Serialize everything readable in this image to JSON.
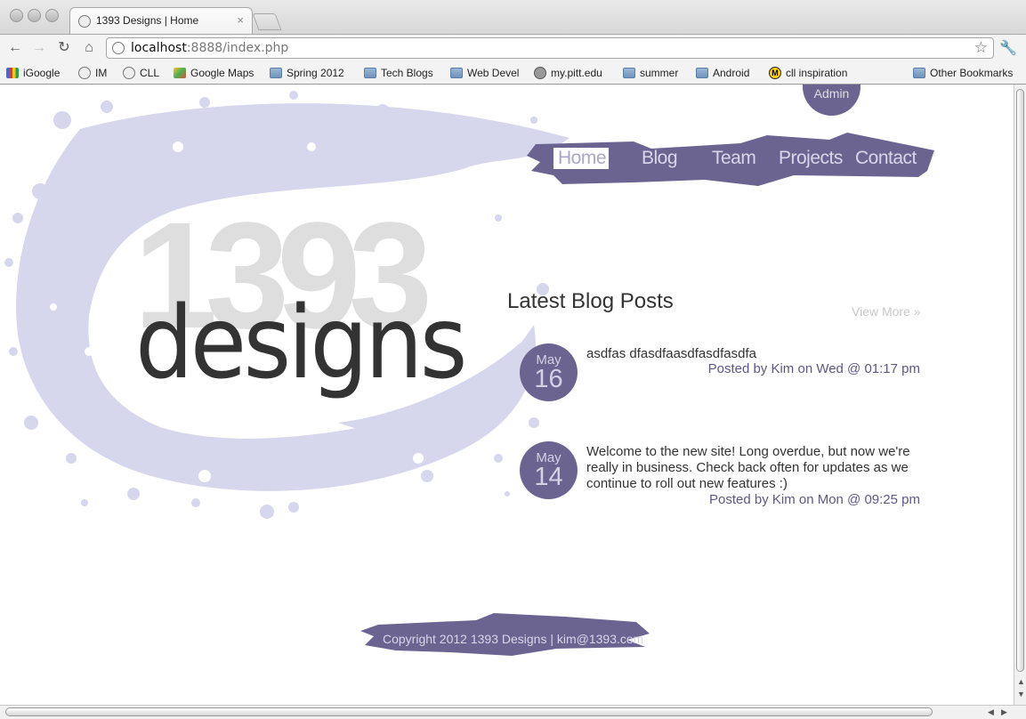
{
  "browser": {
    "tab_title": "1393 Designs | Home",
    "tab_close": "×",
    "url_host": "localhost",
    "url_rest": ":8888/index.php",
    "back_icon": "back-arrow-icon",
    "forward_icon": "forward-arrow-icon",
    "reload_icon": "reload-icon",
    "home_icon": "home-icon",
    "bookmarks": [
      {
        "label": "iGoogle",
        "icon": "google-icon"
      },
      {
        "label": "IM",
        "icon": "globe-icon"
      },
      {
        "label": "CLL",
        "icon": "globe-icon"
      },
      {
        "label": "Google Maps",
        "icon": "maps-icon"
      },
      {
        "label": "Spring 2012",
        "icon": "folder-icon"
      },
      {
        "label": "Tech Blogs",
        "icon": "folder-icon"
      },
      {
        "label": "Web Devel",
        "icon": "folder-icon"
      },
      {
        "label": "my.pitt.edu",
        "icon": "pitt-icon"
      },
      {
        "label": "summer",
        "icon": "folder-icon"
      },
      {
        "label": "Android",
        "icon": "folder-icon"
      },
      {
        "label": "cll inspiration",
        "icon": "m-icon"
      }
    ],
    "other_bookmarks": "Other Bookmarks"
  },
  "site": {
    "logo_number": "1393",
    "logo_word": "designs",
    "admin_label": "Admin",
    "nav": [
      "Home",
      "Blog",
      "Team",
      "Projects",
      "Contact"
    ],
    "brand_color": "#6b6491",
    "blog_heading": "Latest Blog Posts",
    "view_more": "View More »",
    "posts": [
      {
        "month": "May",
        "day": "16",
        "text": "asdfas dfasdfaasdfasdfasdfa",
        "meta": "Posted by Kim on Wed @ 01:17 pm"
      },
      {
        "month": "May",
        "day": "14",
        "text": "Welcome to the new site! Long overdue, but now we're really in business. Check back often for updates as we continue to roll out new features :)",
        "meta": "Posted by Kim on Mon @ 09:25 pm"
      }
    ],
    "footer": "Copyright 2012 1393 Designs | kim@1393.com"
  }
}
